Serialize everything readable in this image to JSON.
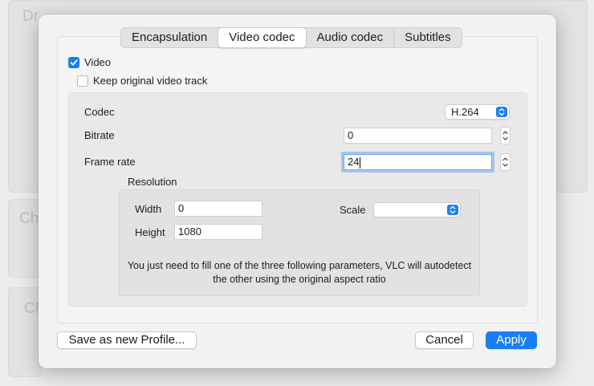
{
  "background": {
    "header_text": "Drop media here",
    "item1_text": "Ch",
    "item2_text": "Ch"
  },
  "tabs": [
    "Encapsulation",
    "Video codec",
    "Audio codec",
    "Subtitles"
  ],
  "selected_tab": "Video codec",
  "video_checkbox": {
    "label": "Video",
    "checked": true
  },
  "keep_original_checkbox": {
    "label": "Keep original video track",
    "checked": false
  },
  "codec": {
    "label": "Codec",
    "value": "H.264"
  },
  "bitrate": {
    "label": "Bitrate",
    "value": "0"
  },
  "frame_rate": {
    "label": "Frame rate",
    "value": "24"
  },
  "resolution": {
    "title": "Resolution",
    "width_label": "Width",
    "width_value": "0",
    "height_label": "Height",
    "height_value": "1080",
    "scale_label": "Scale",
    "scale_value": "",
    "note": "You just need to fill one of the three following parameters, VLC will autodetect the other using the original aspect ratio"
  },
  "buttons": {
    "save_profile": "Save as new Profile...",
    "cancel": "Cancel",
    "apply": "Apply"
  },
  "colors": {
    "accent": "#1a7ff2",
    "sheet_bg": "#f2f2f2"
  }
}
